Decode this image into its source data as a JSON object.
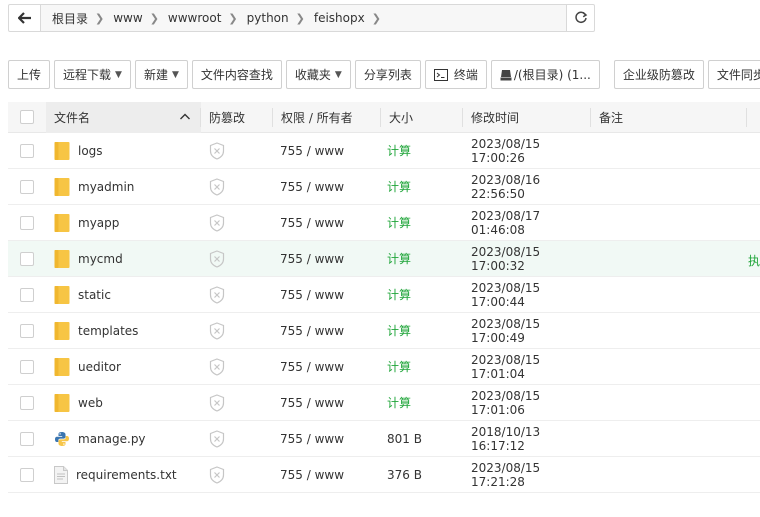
{
  "breadcrumb": {
    "items": [
      "根目录",
      "www",
      "wwwroot",
      "python",
      "feishopx"
    ]
  },
  "toolbar": {
    "upload": "上传",
    "remote_download": "远程下载",
    "new": "新建",
    "content_search": "文件内容查找",
    "favorites": "收藏夹",
    "share_list": "分享列表",
    "terminal": "终端",
    "disk": "/(根目录) (1...",
    "tamper_proof": "企业级防篡改",
    "file_sync": "文件同步"
  },
  "table": {
    "headers": {
      "name": "文件名",
      "guard": "防篡改",
      "perm": "权限 / 所有者",
      "size": "大小",
      "mtime": "修改时间",
      "note": "备注"
    },
    "rows": [
      {
        "name": "logs",
        "type": "folder",
        "perm": "755 / www",
        "size": "计算",
        "mtime": "2023/08/15 17:00:26"
      },
      {
        "name": "myadmin",
        "type": "folder",
        "perm": "755 / www",
        "size": "计算",
        "mtime": "2023/08/16 22:56:50"
      },
      {
        "name": "myapp",
        "type": "folder",
        "perm": "755 / www",
        "size": "计算",
        "mtime": "2023/08/17 01:46:08"
      },
      {
        "name": "mycmd",
        "type": "folder",
        "perm": "755 / www",
        "size": "计算",
        "mtime": "2023/08/15 17:00:32",
        "hover": true,
        "action": "执"
      },
      {
        "name": "static",
        "type": "folder",
        "perm": "755 / www",
        "size": "计算",
        "mtime": "2023/08/15 17:00:44"
      },
      {
        "name": "templates",
        "type": "folder",
        "perm": "755 / www",
        "size": "计算",
        "mtime": "2023/08/15 17:00:49"
      },
      {
        "name": "ueditor",
        "type": "folder",
        "perm": "755 / www",
        "size": "计算",
        "mtime": "2023/08/15 17:01:04"
      },
      {
        "name": "web",
        "type": "folder",
        "perm": "755 / www",
        "size": "计算",
        "mtime": "2023/08/15 17:01:06"
      },
      {
        "name": "manage.py",
        "type": "python",
        "perm": "755 / www",
        "size": "801 B",
        "mtime": "2018/10/13 16:17:12"
      },
      {
        "name": "requirements.txt",
        "type": "text",
        "perm": "755 / www",
        "size": "376 B",
        "mtime": "2023/08/15 17:21:28"
      }
    ]
  },
  "colors": {
    "accent": "#20a53a",
    "folder": "#f7c544",
    "hover_row": "#f1f9f5"
  }
}
